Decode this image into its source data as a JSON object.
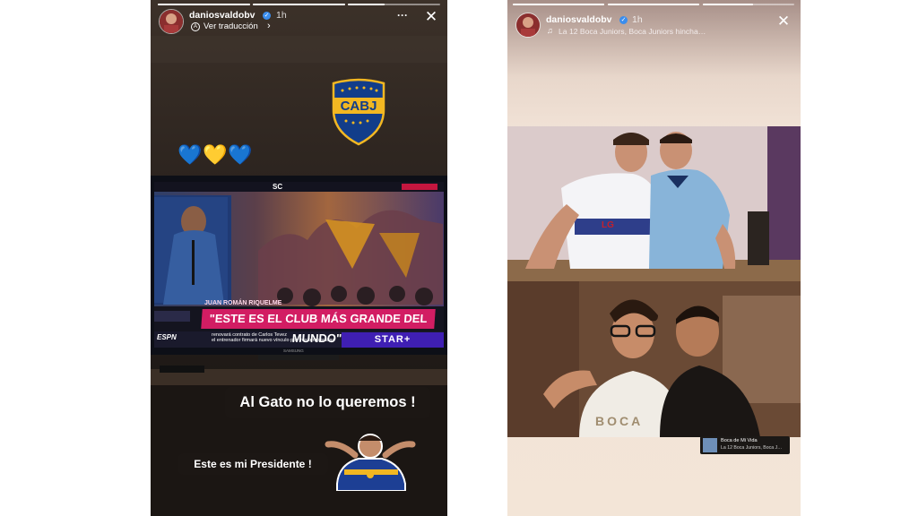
{
  "story_left": {
    "username": "daniosvaldobv",
    "time": "1h",
    "translate_label": "Ver traducción",
    "more_label": "···",
    "close_label": "✕",
    "badge_text": "CABJ",
    "hearts": [
      "💙",
      "💛",
      "💙"
    ],
    "tv": {
      "channel_top": "SC",
      "name_label": "JUAN ROMÁN RIQUELME",
      "headline": "\"ESTE ES EL CLUB MÁS GRANDE DEL MUNDO\"",
      "ticker_line1": "renovará contrato de Carlos Tevez",
      "ticker_line2": "el entrenador firmará nuevo vínculo por tres temporadas",
      "network": "ESPN",
      "streaming": "STAR+",
      "brand": "SAMSUNG"
    },
    "caption_main": "Al Gato no lo queremos !",
    "caption_second": "Este es mi Presidente !"
  },
  "story_right": {
    "username": "daniosvaldobv",
    "time": "1h",
    "music_line": "La 12 Boca Juniors, Boca Juniors hincha…",
    "close_label": "✕",
    "shirt_text": "LG",
    "shirt_text_2": "BOCA",
    "music_sticker_title": "Boca de Mi Vida",
    "music_sticker_artist": "La 12 Boca Juniors, Boca J…"
  },
  "colors": {
    "boca_blue": "#123d8a",
    "boca_gold": "#f2b722",
    "verified_blue": "#3b8ded",
    "espn_pink": "#d21d63",
    "star_plus": "#3f1fb3"
  },
  "icons": {
    "verified": "verified-badge-icon",
    "chevron": "chevron-right-icon",
    "music": "music-note-icon",
    "more": "more-horizontal-icon",
    "close": "close-icon"
  }
}
